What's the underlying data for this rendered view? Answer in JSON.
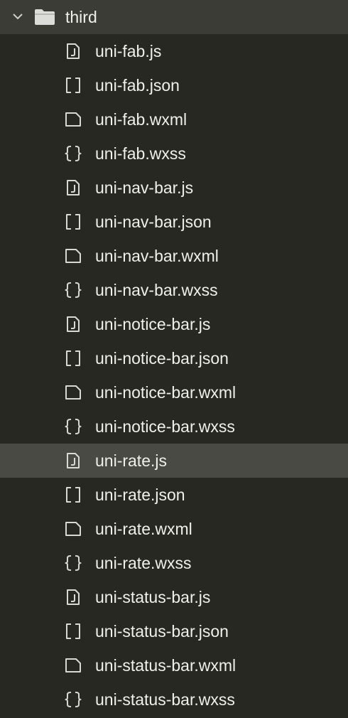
{
  "sidebar": {
    "folder": {
      "label": "third",
      "expanded": true,
      "icon": "chevron-down-icon"
    },
    "selected_index": 12,
    "files": [
      {
        "label": "uni-fab.js",
        "icon": "js-file-icon"
      },
      {
        "label": "uni-fab.json",
        "icon": "json-file-icon"
      },
      {
        "label": "uni-fab.wxml",
        "icon": "document-file-icon"
      },
      {
        "label": "uni-fab.wxss",
        "icon": "css-file-icon"
      },
      {
        "label": "uni-nav-bar.js",
        "icon": "js-file-icon"
      },
      {
        "label": "uni-nav-bar.json",
        "icon": "json-file-icon"
      },
      {
        "label": "uni-nav-bar.wxml",
        "icon": "document-file-icon"
      },
      {
        "label": "uni-nav-bar.wxss",
        "icon": "css-file-icon"
      },
      {
        "label": "uni-notice-bar.js",
        "icon": "js-file-icon"
      },
      {
        "label": "uni-notice-bar.json",
        "icon": "json-file-icon"
      },
      {
        "label": "uni-notice-bar.wxml",
        "icon": "document-file-icon"
      },
      {
        "label": "uni-notice-bar.wxss",
        "icon": "css-file-icon"
      },
      {
        "label": "uni-rate.js",
        "icon": "js-file-icon"
      },
      {
        "label": "uni-rate.json",
        "icon": "json-file-icon"
      },
      {
        "label": "uni-rate.wxml",
        "icon": "document-file-icon"
      },
      {
        "label": "uni-rate.wxss",
        "icon": "css-file-icon"
      },
      {
        "label": "uni-status-bar.js",
        "icon": "js-file-icon"
      },
      {
        "label": "uni-status-bar.json",
        "icon": "json-file-icon"
      },
      {
        "label": "uni-status-bar.wxml",
        "icon": "document-file-icon"
      },
      {
        "label": "uni-status-bar.wxss",
        "icon": "css-file-icon"
      }
    ]
  },
  "colors": {
    "background": "#272822",
    "folder_row": "#3b3c36",
    "selected_row": "#4a4a45",
    "text": "#f0f0eb",
    "icon": "#d8d8d4"
  }
}
